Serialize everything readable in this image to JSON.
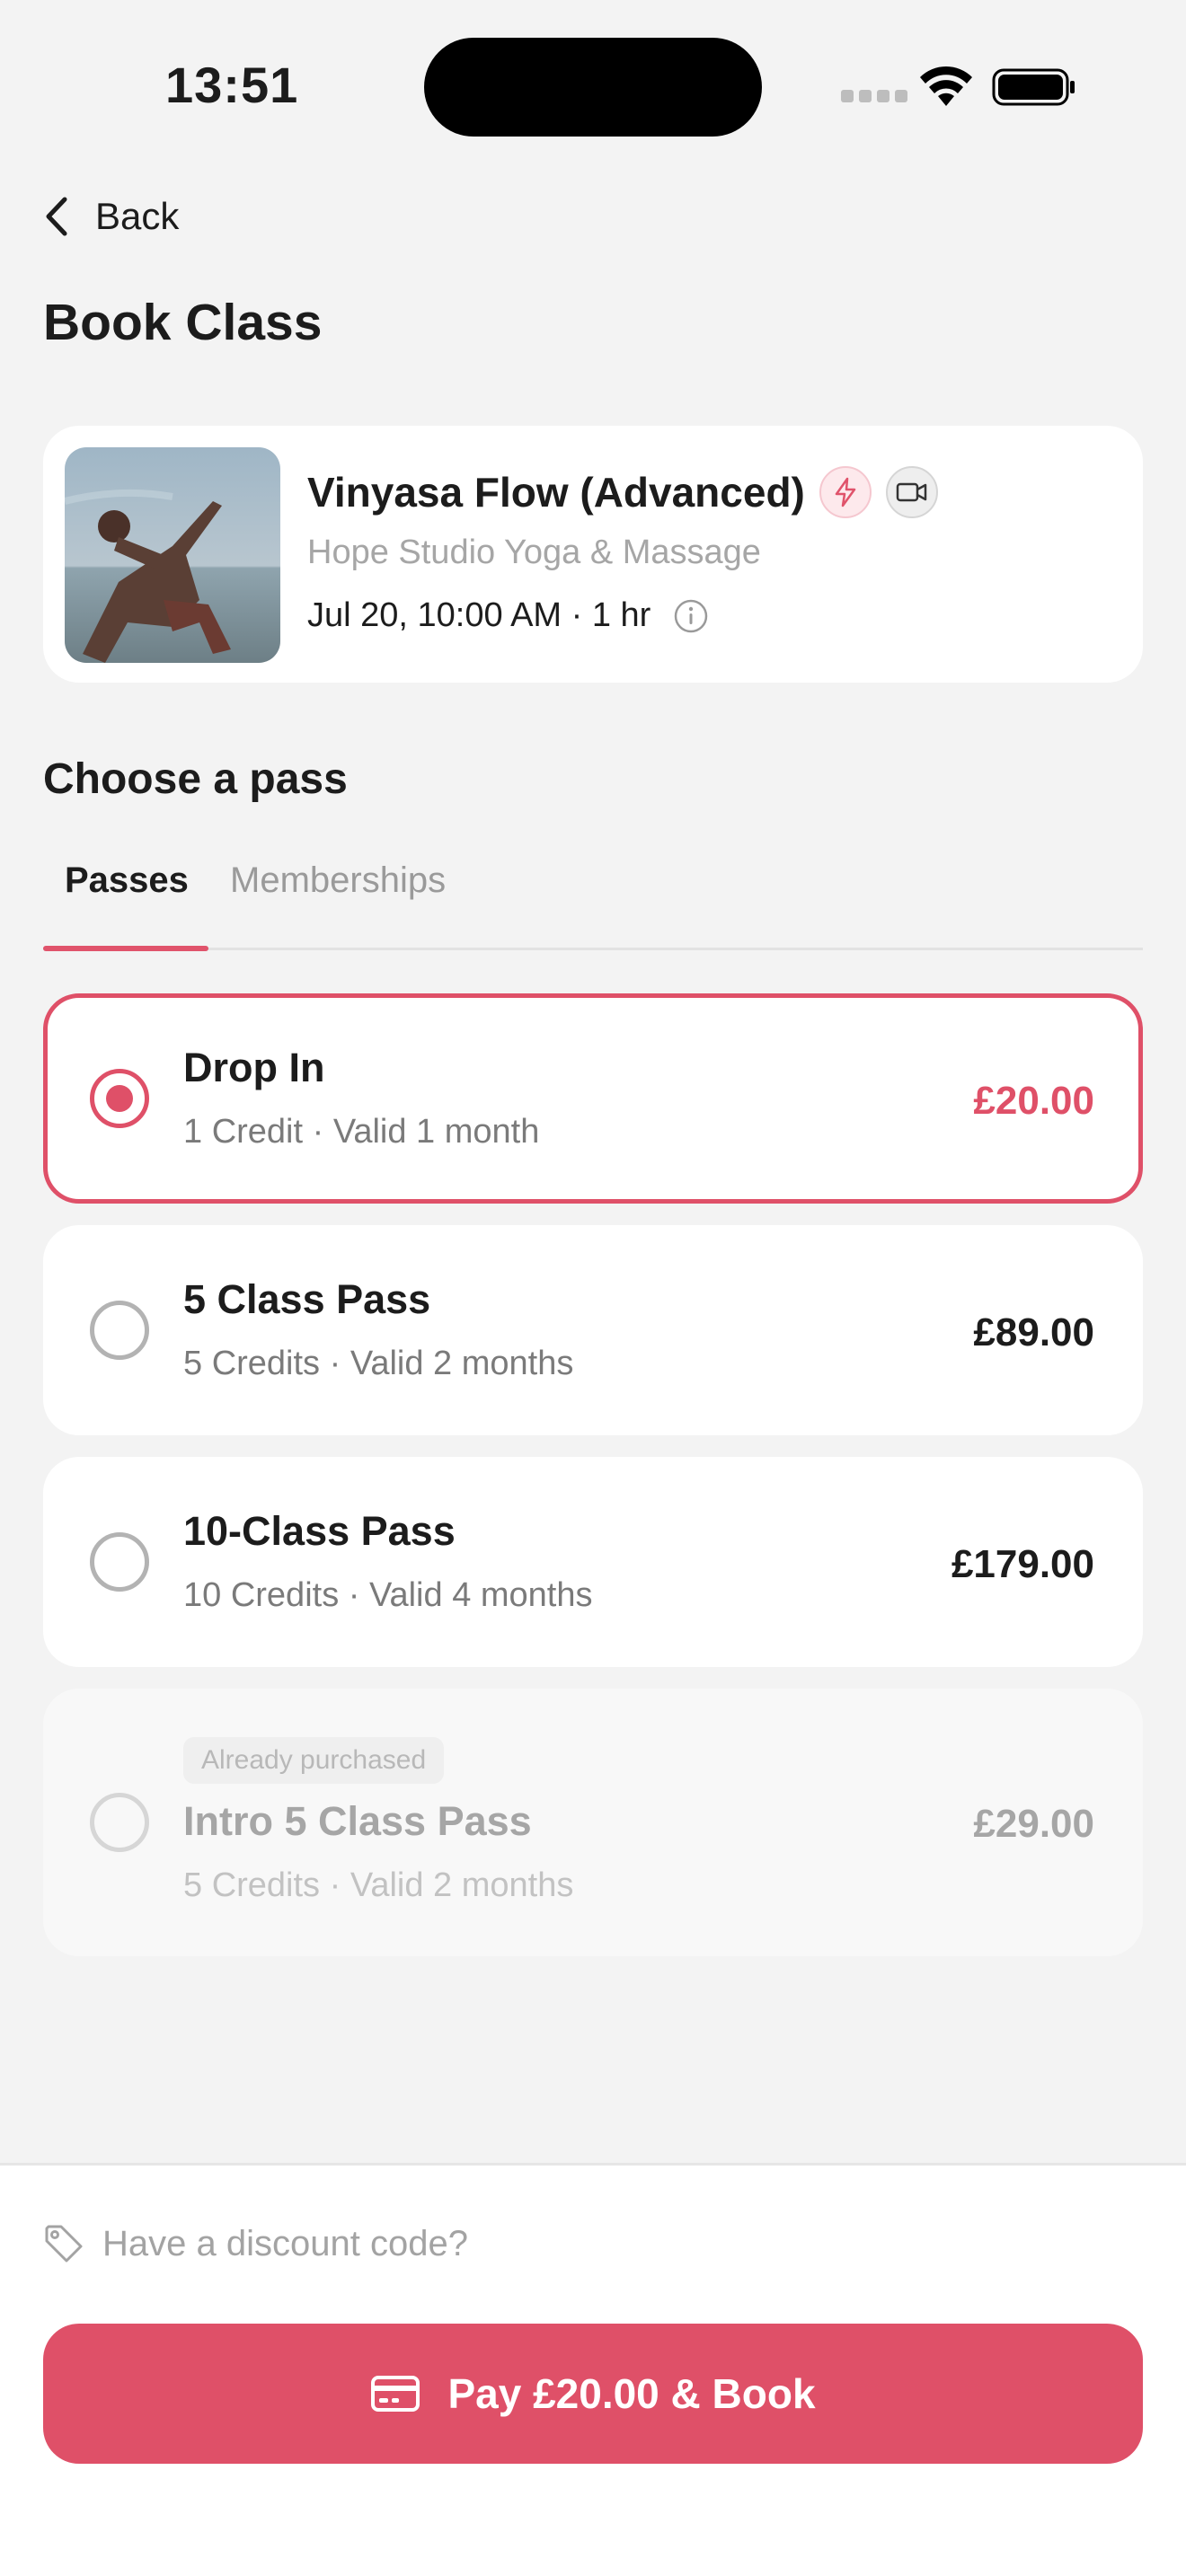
{
  "status_bar": {
    "time": "13:51"
  },
  "header": {
    "back_label": "Back",
    "title": "Book Class"
  },
  "class": {
    "title": "Vinyasa Flow (Advanced)",
    "studio": "Hope Studio Yoga & Massage",
    "datetime": "Jul 20, 10:00 AM · 1 hr",
    "badges": [
      "bolt-icon",
      "video-icon"
    ]
  },
  "choose": {
    "title": "Choose a pass",
    "tabs": [
      {
        "label": "Passes",
        "active": true
      },
      {
        "label": "Memberships",
        "active": false
      }
    ]
  },
  "passes": [
    {
      "name": "Drop In",
      "details": "1 Credit · Valid 1 month",
      "price": "£20.00",
      "selected": true
    },
    {
      "name": "5 Class Pass",
      "details": "5 Credits · Valid 2 months",
      "price": "£89.00",
      "selected": false
    },
    {
      "name": "10-Class Pass",
      "details": "10 Credits · Valid 4 months",
      "price": "£179.00",
      "selected": false
    },
    {
      "name": "Intro 5 Class Pass",
      "details": "5 Credits · Valid 2 months",
      "price": "£29.00",
      "selected": false,
      "tag": "Already purchased",
      "disabled": true
    }
  ],
  "footer": {
    "discount_label": "Have a discount code?",
    "pay_label": "Pay £20.00 & Book"
  },
  "colors": {
    "accent": "#df5068",
    "background": "#f3f3f3"
  }
}
